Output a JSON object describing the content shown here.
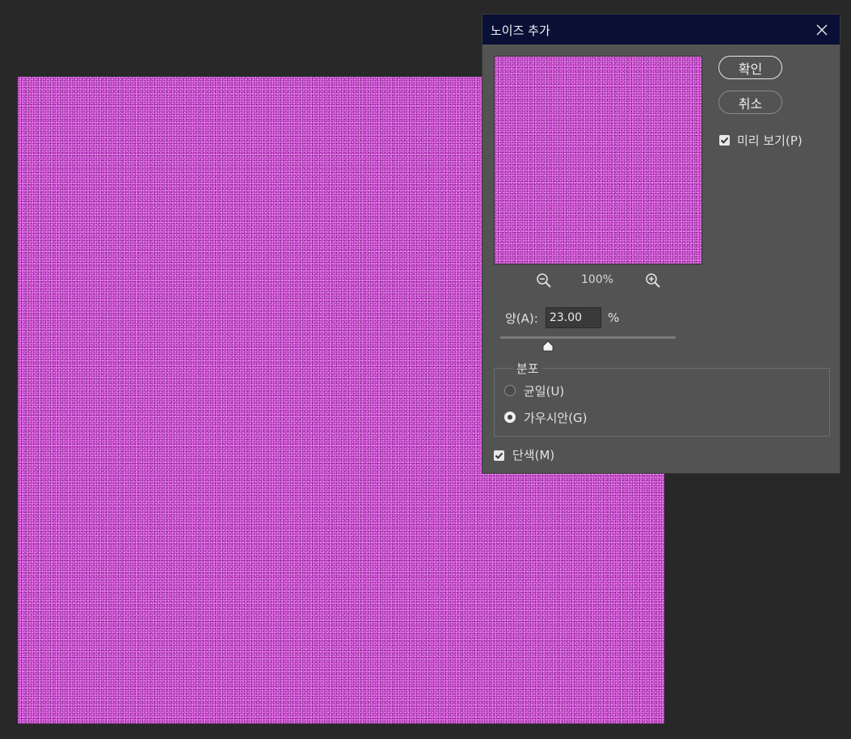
{
  "dialog": {
    "title": "노이즈 추가",
    "ok_label": "확인",
    "cancel_label": "취소",
    "preview_label": "미리 보기(P)",
    "preview_checked": true,
    "zoom_level": "100%",
    "amount_label": "양(A):",
    "amount_value": "23.00",
    "amount_unit": "%",
    "distribution_label": "분포",
    "uniform_label": "균일(U)",
    "gaussian_label": "가우시안(G)",
    "selected_distribution": "gaussian",
    "monochromatic_label": "단색(M)",
    "monochromatic_checked": true
  },
  "icons": {
    "close": "close-icon",
    "zoom_out": "zoom-out-icon",
    "zoom_in": "zoom-in-icon",
    "check": "check-icon"
  },
  "colors": {
    "noise_base": "#e461e8",
    "titlebar": "#0a0f35",
    "dialog_bg": "#535353",
    "workspace_bg": "#282828"
  }
}
